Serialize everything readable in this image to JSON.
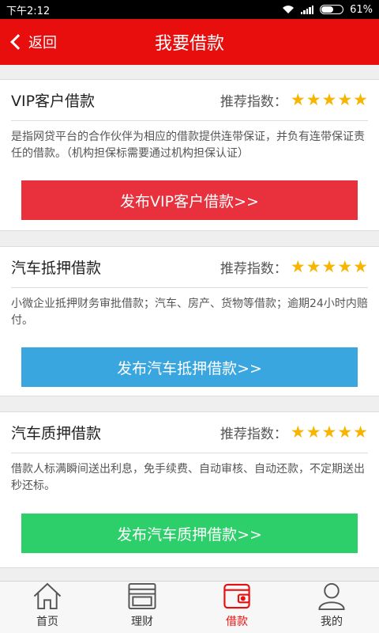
{
  "status_bar": {
    "time": "下午2:12",
    "battery": "61%",
    "battery_level": 0.61
  },
  "nav": {
    "back_label": "返回",
    "title": "我要借款"
  },
  "rating_label": "推荐指数：",
  "cards": [
    {
      "title": "VIP客户借款",
      "stars": 5,
      "desc": "是指网贷平台的合作伙伴为相应的借款提供连带保证，并负有连带保证责任的借款。（机构担保标需要通过机构担保认证）",
      "button": "发布VIP客户借款>>",
      "button_color": "#e8313c"
    },
    {
      "title": "汽车抵押借款",
      "stars": 5,
      "desc": "小微企业抵押财务审批借款；汽车、房产、货物等借款；逾期24小时内赔付。",
      "button": "发布汽车抵押借款>>",
      "button_color": "#3aa6e0"
    },
    {
      "title": "汽车质押借款",
      "stars": 5,
      "desc": "借款人标满瞬间送出利息，免手续费、自动审核、自动还款，不定期送出秒还标。",
      "button": "发布汽车质押借款>>",
      "button_color": "#2ccf6a"
    }
  ],
  "tabs": [
    {
      "label": "首页",
      "icon": "home-icon",
      "active": false
    },
    {
      "label": "理财",
      "icon": "wallet-icon",
      "active": false
    },
    {
      "label": "借款",
      "icon": "loan-icon",
      "active": true
    },
    {
      "label": "我的",
      "icon": "user-icon",
      "active": false
    }
  ],
  "colors": {
    "brand_red": "#e80e0e",
    "star": "#f7b500"
  }
}
